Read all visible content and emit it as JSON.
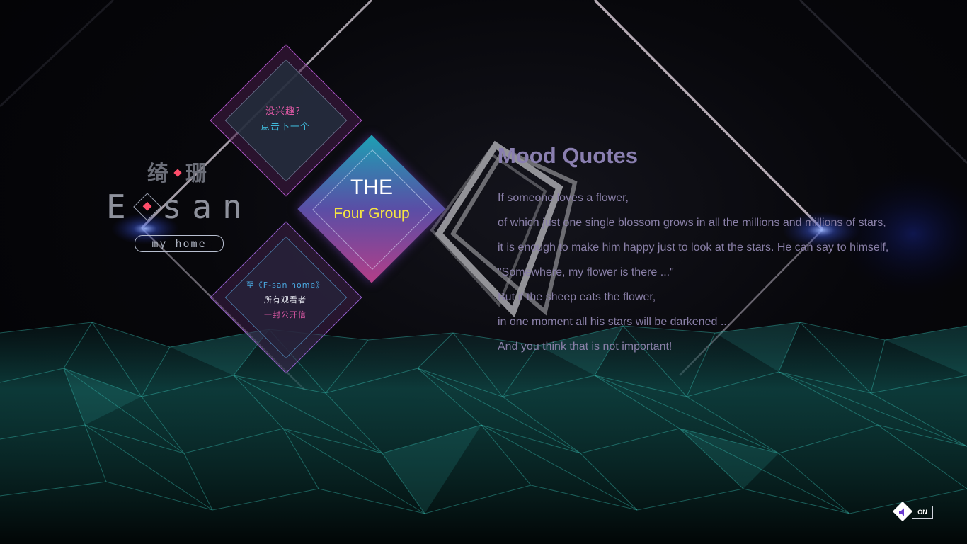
{
  "logo": {
    "chinese_left": "绮",
    "chinese_right": "珊",
    "english_first": "E",
    "english_rest": "san",
    "tagline": "my home"
  },
  "tiles": {
    "next": {
      "line1": "没兴趣？",
      "line2": "点击下一个"
    },
    "group": {
      "line1": "THE",
      "line2": "Four Group"
    },
    "letter": {
      "line1": "至《F-san home》",
      "line2": "所有观看者",
      "line3": "一封公开信"
    }
  },
  "quotes": {
    "title": "Mood Quotes",
    "lines": [
      "If someone loves a flower,",
      "of which just one single blossom grows in all the millions and millions of stars,",
      "it is enough to make him happy just to look at the stars. He can say to himself,",
      "\"Somewhere, my flower is there ...\"",
      "But if the sheep eats the flower,",
      "in one moment all his stars will be darkened ...",
      "And you think that is not important!"
    ]
  },
  "sound": {
    "label": "ON",
    "icon": "speaker-icon"
  },
  "colors": {
    "accent_pink": "#ff4d6a",
    "tile_cyan": "#1da0b4",
    "tile_magenta": "#b43e88",
    "group_yellow": "#f5e442",
    "terrain_teal": "#2fb5ac"
  }
}
